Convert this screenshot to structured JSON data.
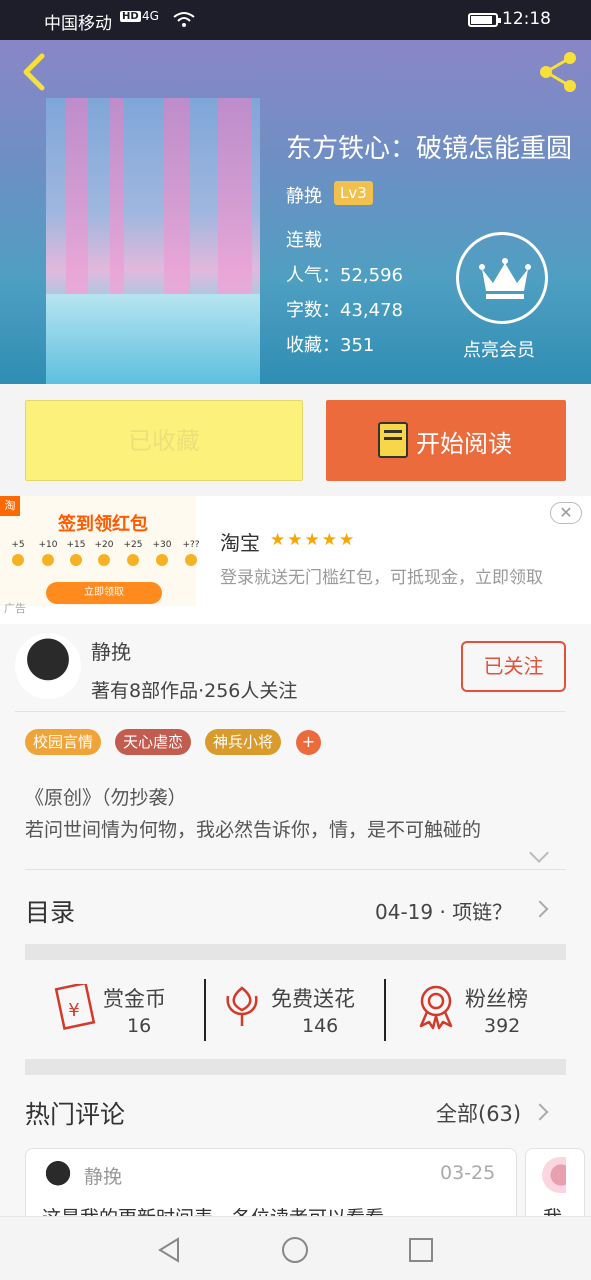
{
  "status_bar": {
    "carrier": "中国移动",
    "hd": "HD",
    "signal": "4G",
    "time": "12:18"
  },
  "book": {
    "title": "东方铁心：破镜怎能重圆",
    "author": "静挽",
    "level": "Lv3",
    "status": "连载",
    "popularity": "人气：52,596",
    "words": "字数：43,478",
    "favorites": "收藏：351",
    "vip_label": "点亮会员"
  },
  "actions": {
    "favorited_label": "已收藏",
    "read_label": "开始阅读"
  },
  "ad": {
    "tag": "淘",
    "headline": "签到领红包",
    "coins": [
      "+5",
      "+10",
      "+15",
      "+20",
      "+25",
      "+30",
      "+??"
    ],
    "button": "立即领取",
    "label": "广告",
    "name": "淘宝",
    "stars": "★★★★★",
    "description": "登录就送无门槛红包，可抵现金，立即领取",
    "close": "✕"
  },
  "author": {
    "name": "静挽",
    "works": "著有8部作品·256人关注",
    "follow_label": "已关注"
  },
  "tags": [
    {
      "label": "校园言情",
      "color": "#f0a438"
    },
    {
      "label": "天心虐恋",
      "color": "#c25c4e"
    },
    {
      "label": "神兵小将",
      "color": "#d99b2b"
    }
  ],
  "tag_add": "+",
  "description": {
    "line1": "《原创》（勿抄袭）",
    "line2": "若问世间情为何物，我必然告诉你，情，是不可触碰的"
  },
  "toc": {
    "title": "目录",
    "latest": "04-19 · 项链？"
  },
  "stats": [
    {
      "label": "赏金币",
      "value": "16",
      "icon": "red-envelope-icon"
    },
    {
      "label": "免费送花",
      "value": "146",
      "icon": "flower-icon"
    },
    {
      "label": "粉丝榜",
      "value": "392",
      "icon": "medal-icon"
    }
  ],
  "comments": {
    "title": "热门评论",
    "all_label": "全部(63)",
    "items": [
      {
        "user": "静挽",
        "date": "03-25",
        "text": "这是我的更新时间表，各位读者可以看看"
      },
      {
        "text": "我"
      }
    ]
  },
  "colors": {
    "accent": "#ec6b3d",
    "favorite_bg": "#fcf17b",
    "follow": "#e2523a"
  }
}
